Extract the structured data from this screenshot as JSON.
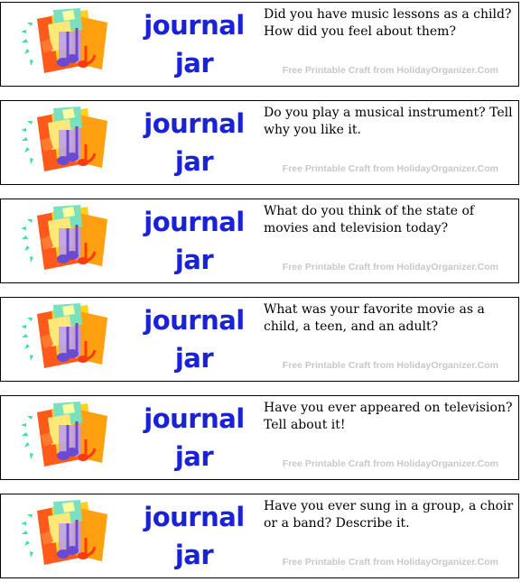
{
  "cards": [
    {
      "brand": [
        "journal",
        "jar"
      ],
      "question": "Did you have music lessons as a child?  How did you feel about them?",
      "credit": "Free Printable Craft from HolidayOrganizer.Com"
    },
    {
      "brand": [
        "journal",
        "jar"
      ],
      "question": "Do you play a musical instrument? Tell why you like it.",
      "credit": "Free Printable Craft from HolidayOrganizer.Com"
    },
    {
      "brand": [
        "journal",
        "jar"
      ],
      "question": "What do you think of the state of movies and television today?",
      "credit": "Free Printable Craft from HolidayOrganizer.Com"
    },
    {
      "brand": [
        "journal",
        "jar"
      ],
      "question": "What was your favorite movie as a child, a teen, and an adult?",
      "credit": "Free Printable Craft from HolidayOrganizer.Com"
    },
    {
      "brand": [
        "journal",
        "jar"
      ],
      "question": "Have you ever appeared on television?  Tell about it!",
      "credit": "Free Printable Craft from HolidayOrganizer.Com"
    },
    {
      "brand": [
        "journal",
        "jar"
      ],
      "question": "Have you ever sung in a group, a choir or a band?  Describe it.",
      "credit": "Free Printable Craft from HolidayOrganizer.Com"
    }
  ],
  "icon": "music-notes-collage-icon",
  "colors": {
    "brand_text": "#1a22d6",
    "credit_text": "#c8c8c8",
    "border": "#000000"
  }
}
